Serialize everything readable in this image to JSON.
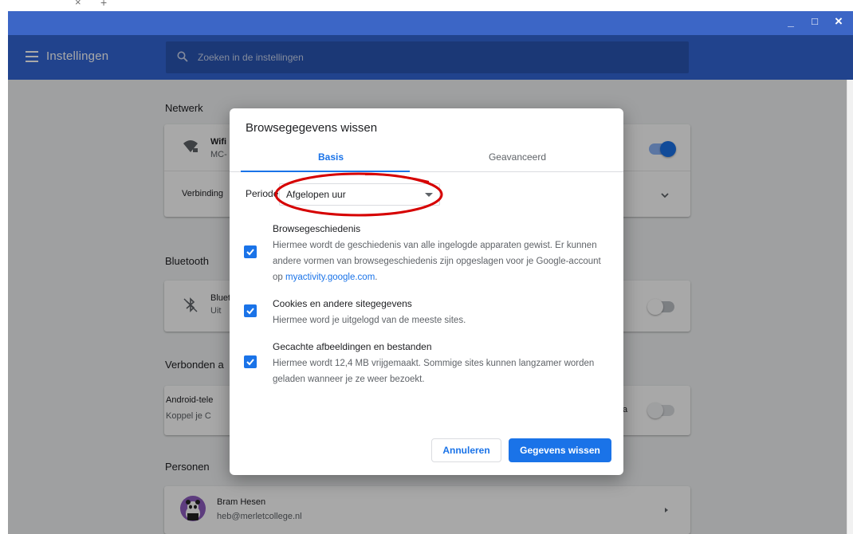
{
  "tabstrip": {
    "close_glyph": "×",
    "new_tab_glyph": "+"
  },
  "window": {
    "minimize": "_",
    "maximize": "□",
    "close": "×"
  },
  "header": {
    "title": "Instellingen",
    "search_placeholder": "Zoeken in de instellingen"
  },
  "sections": {
    "network": {
      "title": "Netwerk",
      "wifi_title": "Wifi",
      "wifi_sub": "MC-",
      "connection_label": "Verbinding"
    },
    "bluetooth": {
      "title": "Bluetooth",
      "bt_title": "Bluet",
      "bt_sub": "Uit"
    },
    "connected": {
      "title": "Verbonden a",
      "android_title": "Android-tele",
      "android_sub": "Koppel je C",
      "android_tail": "a"
    },
    "people": {
      "title": "Personen",
      "user_name": "Bram Hesen",
      "user_email": "heb@merletcollege.nl"
    }
  },
  "dialog": {
    "title": "Browsegegevens wissen",
    "tabs": [
      {
        "label": "Basis"
      },
      {
        "label": "Geavanceerd"
      }
    ],
    "period_label": "Periode",
    "period_value": "Afgelopen uur",
    "options": [
      {
        "title": "Browsegeschiedenis",
        "desc_before": "Hiermee wordt de geschiedenis van alle ingelogde apparaten gewist. Er kunnen andere vormen van browsegeschiedenis zijn opgeslagen voor je Google-account op ",
        "link": "myactivity.google.com",
        "desc_after": "."
      },
      {
        "title": "Cookies en andere sitegegevens",
        "desc": "Hiermee word je uitgelogd van de meeste sites."
      },
      {
        "title": "Gecachte afbeeldingen en bestanden",
        "desc": "Hiermee wordt 12,4 MB vrijgemaakt. Sommige sites kunnen langzamer worden geladen wanneer je ze weer bezoekt."
      }
    ],
    "cancel_label": "Annuleren",
    "clear_label": "Gegevens wissen"
  },
  "colors": {
    "accent": "#1a73e8",
    "header_blue": "#3367d6",
    "annotation_red": "#d60000",
    "avatar_purple": "#8e5bc0"
  }
}
